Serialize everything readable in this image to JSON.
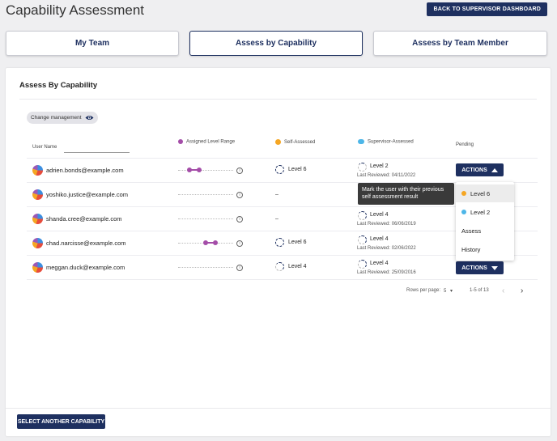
{
  "header": {
    "title": "Capability Assessment",
    "back_button": "BACK TO SUPERVISOR DASHBOARD"
  },
  "tabs": [
    {
      "label": "My Team",
      "active": false
    },
    {
      "label": "Assess by Capability",
      "active": true
    },
    {
      "label": "Assess by Team Member",
      "active": false
    }
  ],
  "card": {
    "title": "Assess By Capability",
    "capability_chip": "Change management",
    "columns": {
      "user_name": "User Name",
      "assigned_range": "Assigned Level Range",
      "self_assessed": "Self-Assessed",
      "supervisor_assessed": "Supervisor-Assessed",
      "pending": "Pending"
    },
    "rows": [
      {
        "email": "adrien.bonds@example.com",
        "range": [
          0.2,
          0.38
        ],
        "self": "Level 6",
        "supervisor": "Level 2",
        "reviewed": "Last Reviewed: 04/11/2022",
        "actions": "ACTIONS"
      },
      {
        "email": "yoshiko.justice@example.com",
        "range": null,
        "self": "–",
        "supervisor": "",
        "reviewed": "",
        "actions": ""
      },
      {
        "email": "shanda.cree@example.com",
        "range": null,
        "self": "–",
        "supervisor": "Level 4",
        "reviewed": "Last Reviewed: 06/06/2019",
        "actions": ""
      },
      {
        "email": "chad.narcisse@example.com",
        "range": [
          0.5,
          0.68
        ],
        "self": "Level 6",
        "supervisor": "Level 4",
        "reviewed": "Last Reviewed: 02/06/2022",
        "actions": ""
      },
      {
        "email": "meggan.duck@example.com",
        "range": null,
        "self": "Level 4",
        "supervisor": "Level 4",
        "reviewed": "Last Reviewed: 25/09/2016",
        "actions": "ACTIONS"
      }
    ],
    "tooltip": "Mark the user with their previous self assessment result",
    "menu": [
      {
        "label": "Level 6",
        "dot": "#f5a623"
      },
      {
        "label": "Level 2",
        "dot": "#4db6e8"
      },
      {
        "label": "Assess",
        "dot": ""
      },
      {
        "label": "History",
        "dot": ""
      }
    ],
    "pagination": {
      "rows_label": "Rows per page:",
      "rows_value": "5",
      "range_text": "1-5 of 13"
    },
    "footer_button": "SELECT ANOTHER CAPABILITY"
  },
  "colors": {
    "primary": "#1e3060",
    "range": "#a44da8",
    "self_icon": "#f5a623",
    "supervisor_icon": "#4db6e8"
  }
}
